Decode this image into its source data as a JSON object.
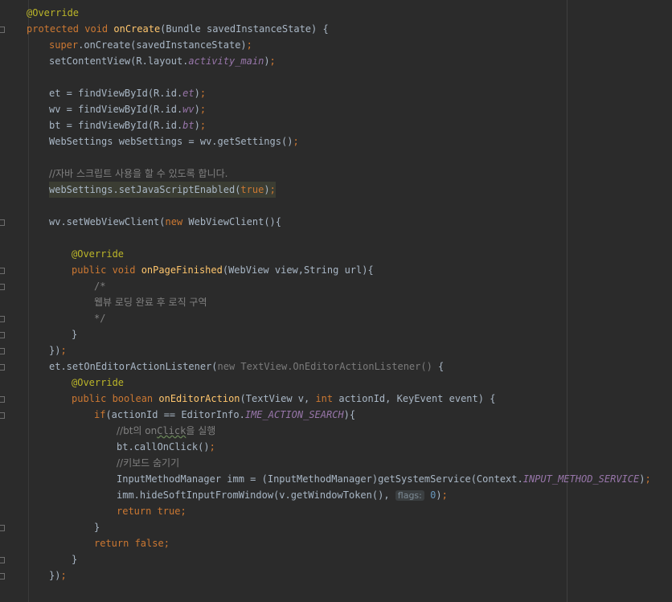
{
  "lines": {
    "l1": {
      "annotation": "@Override"
    },
    "l2": {
      "kw": "protected void ",
      "fn": "onCreate",
      "rest": "(Bundle savedInstanceState) {"
    },
    "l3": {
      "kw": "super",
      "rest": ".onCreate(savedInstanceState)",
      "semi": ";"
    },
    "l4": {
      "a": "setContentView(R.layout.",
      "field": "activity_main",
      "b": ")",
      "semi": ";"
    },
    "l5": {
      "a": "et = findViewById(R.id.",
      "field": "et",
      "b": ")",
      "semi": ";"
    },
    "l6": {
      "a": "wv = findViewById(R.id.",
      "field": "wv",
      "b": ")",
      "semi": ";"
    },
    "l7": {
      "a": "bt = findViewById(R.id.",
      "field": "bt",
      "b": ")",
      "semi": ";"
    },
    "l8": {
      "a": "WebSettings webSettings = wv.getSettings()",
      "semi": ";"
    },
    "l9": {
      "comment": "//자바 스크립트 사용을 할 수 있도록 합니다."
    },
    "l10": {
      "a": "webSettings.setJavaScriptEnabled(",
      "kw": "true",
      "b": ")",
      "semi": ";"
    },
    "l11": {
      "a": "wv.setWebViewClient(",
      "kw": "new ",
      "b": "WebViewClient(){"
    },
    "l12": {
      "annotation": "@Override"
    },
    "l13": {
      "kw": "public void ",
      "fn": "onPageFinished",
      "rest": "(WebView view,String url){"
    },
    "l14": {
      "comment": "/*"
    },
    "l15": {
      "comment": "웹뷰 로딩 완료 후 로직 구역"
    },
    "l16": {
      "comment": "*/"
    },
    "l17": {
      "text": "}"
    },
    "l18": {
      "text": "})",
      "semi": ";"
    },
    "l19": {
      "a": "et.setOnEditorActionListener(",
      "muted": "new TextView.OnEditorActionListener()",
      "b": " {"
    },
    "l20": {
      "annotation": "@Override"
    },
    "l21": {
      "kw": "public boolean ",
      "fn": "onEditorAction",
      "a": "(TextView v, ",
      "kw2": "int ",
      "b": "actionId, KeyEvent event) {"
    },
    "l22": {
      "kw": "if",
      "a": "(actionId == EditorInfo.",
      "field": "IME_ACTION_SEARCH",
      "b": "){"
    },
    "l23": {
      "c1": "//bt의 on",
      "c2": "Click",
      "c3": "을 실행"
    },
    "l24": {
      "a": "bt.callOnClick()",
      "semi": ";"
    },
    "l25": {
      "comment": "//키보드 숨기기"
    },
    "l26": {
      "a": "InputMethodManager imm = (InputMethodManager)getSystemService(Context.",
      "field": "INPUT_METHOD_SERVICE",
      "b": ")",
      "semi": ";"
    },
    "l27": {
      "a": "imm.hideSoftInputFromWindow(v.getWindowToken(), ",
      "hint": "flags:",
      "num": "0",
      "b": ")",
      "semi": ";"
    },
    "l28": {
      "kw": "return true",
      "semi": ";"
    },
    "l29": {
      "text": "}"
    },
    "l30": {
      "kw": "return false",
      "semi": ";"
    },
    "l31": {
      "text": "}"
    },
    "l32": {
      "text": "})",
      "semi": ";"
    }
  },
  "colors": {
    "background": "#2b2b2b",
    "keyword": "#cc7832",
    "method": "#ffc66d",
    "annotation": "#bbb529",
    "field": "#9876aa",
    "comment": "#808080",
    "text": "#a9b7c6"
  }
}
